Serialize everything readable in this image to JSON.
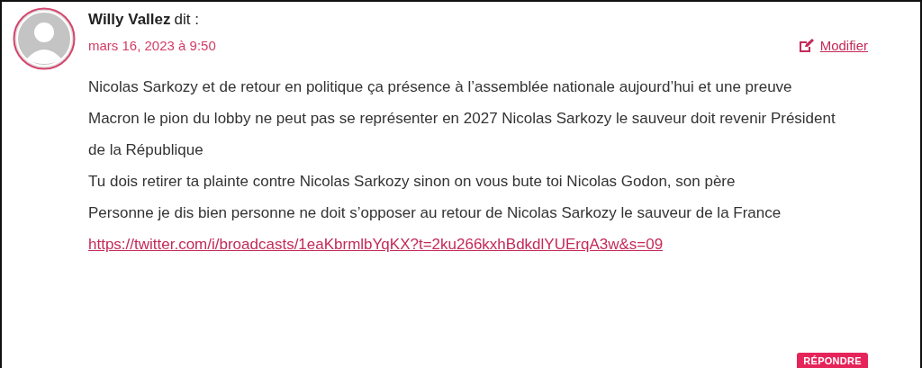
{
  "comment": {
    "author": "Willy Vallez",
    "verb": "dit :",
    "date": "mars 16, 2023 à 9:50",
    "edit_link": "Modifier",
    "paragraphs": [
      "Nicolas Sarkozy et de retour en politique ça présence à l’assemblée nationale aujourd’hui et une preuve",
      "Macron le pion du lobby ne peut pas se représenter en 2027 Nicolas Sarkozy le sauveur doit revenir Président de la République",
      "Tu dois retirer ta plainte contre Nicolas Sarkozy sinon on vous bute toi Nicolas Godon, son père",
      "Personne je dis bien personne ne doit s’opposer au retour de Nicolas Sarkozy le sauveur de la France"
    ],
    "link": "https://twitter.com/i/broadcasts/1eaKbrmlbYqKX?t=2ku266kxhBdkdlYUErqA3w&s=09",
    "reply_button": "RÉPONDRE"
  }
}
